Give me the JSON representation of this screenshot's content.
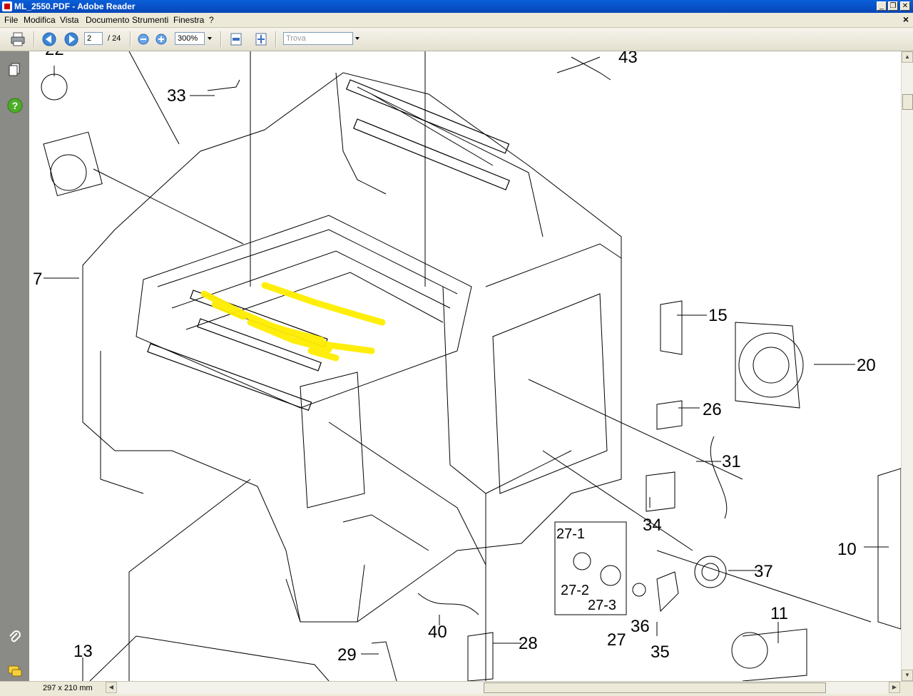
{
  "window": {
    "title": "ML_2550.PDF - Adobe Reader",
    "controls": [
      "minimize",
      "restore",
      "close"
    ]
  },
  "menu": {
    "items": [
      "File",
      "Modifica",
      "Vista",
      "Documento",
      "Strumenti",
      "Finestra",
      "?"
    ],
    "close_doc": "×"
  },
  "toolbar": {
    "page_current": "2",
    "page_total": "/ 24",
    "zoom": "300%",
    "find_placeholder": "Trova"
  },
  "diagram_labels": {
    "l22": "22",
    "l33": "33",
    "l43": "43",
    "l7": "7",
    "l15": "15",
    "l20": "20",
    "l26": "26",
    "l31": "31",
    "l34": "34",
    "l10": "10",
    "l37": "37",
    "l27_1": "27-1",
    "l27_2": "27-2",
    "l27_3": "27-3",
    "l27": "27",
    "l36": "36",
    "l35": "35",
    "l11": "11",
    "l40": "40",
    "l28": "28",
    "l29": "29",
    "l13": "13"
  },
  "status": {
    "page_size": "297 x 210 mm"
  },
  "colors": {
    "titlebar": "#0a5fd8",
    "highlight": "#ffee00",
    "left_panel": "#8a8a86"
  }
}
